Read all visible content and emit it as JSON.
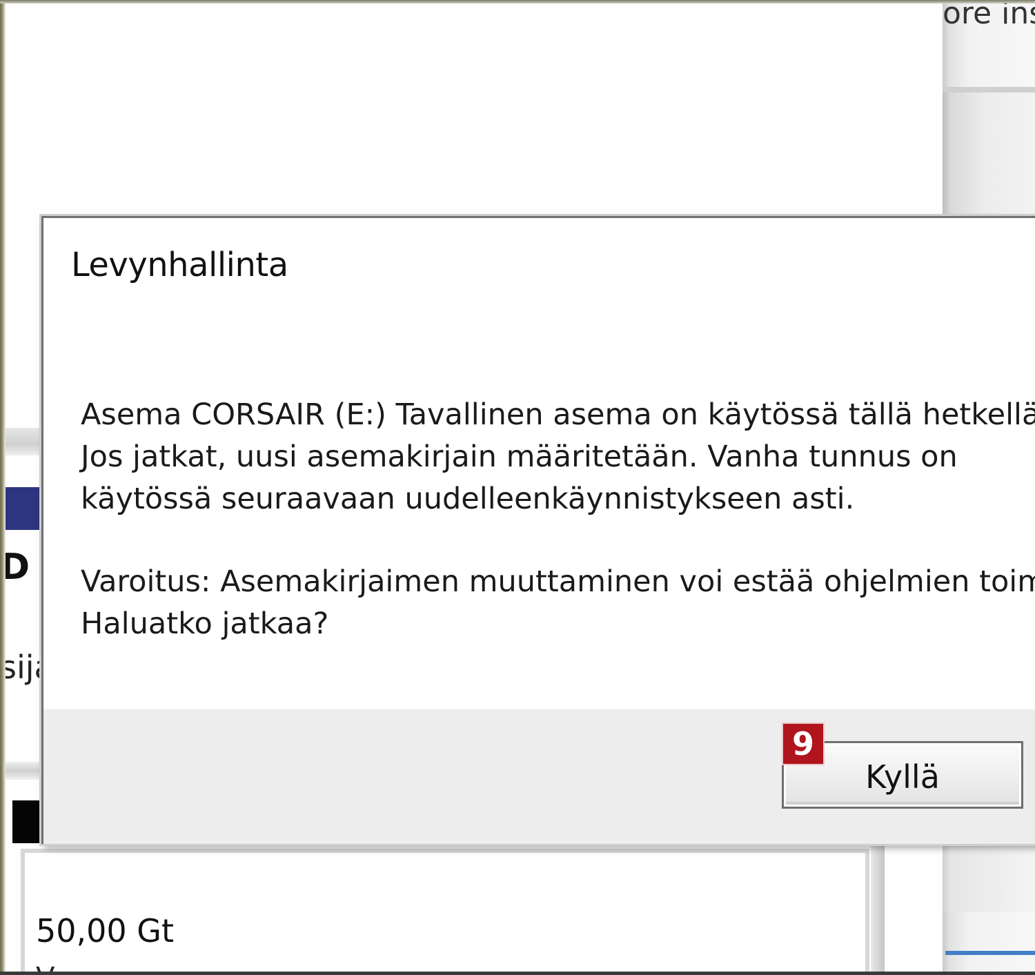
{
  "background": {
    "top_right_text": "ore ins",
    "left_letter": "D",
    "left_fragment": "sija",
    "disk_size": "50,00 Gt",
    "disk_size_below": "V"
  },
  "dialog": {
    "title": "Levynhallinta",
    "message_lines": [
      "Asema CORSAIR (E:) Tavallinen asema on käytössä tällä hetkellä.",
      "Jos jatkat, uusi asemakirjain määritetään. Vanha tunnus on",
      "käytössä seuraavaan uudelleenkäynnistykseen asti."
    ],
    "warning_lines": [
      "Varoitus: Asemakirjaimen muuttaminen voi estää ohjelmien toiminnan.",
      "Haluatko jatkaa?"
    ],
    "yes_button_label": "Kyllä",
    "step_badge": "9"
  },
  "colors": {
    "badge": "#b0141d",
    "navy_strip": "#2e3580",
    "scroll_blue": "#3f7fc7"
  }
}
